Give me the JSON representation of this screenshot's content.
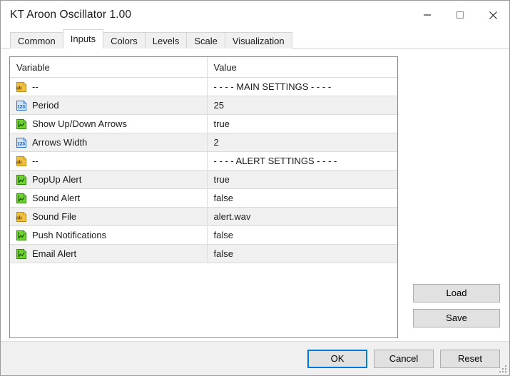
{
  "window": {
    "title": "KT Aroon Oscillator 1.00",
    "controls": [
      {
        "name": "minimize-button",
        "glyph": "minimize"
      },
      {
        "name": "maximize-button",
        "glyph": "maximize"
      },
      {
        "name": "close-button",
        "glyph": "close"
      }
    ]
  },
  "tabs": [
    {
      "label": "Common",
      "active": false
    },
    {
      "label": "Inputs",
      "active": true
    },
    {
      "label": "Colors",
      "active": false
    },
    {
      "label": "Levels",
      "active": false
    },
    {
      "label": "Scale",
      "active": false
    },
    {
      "label": "Visualization",
      "active": false
    }
  ],
  "table": {
    "headers": {
      "variable": "Variable",
      "value": "Value"
    },
    "rows": [
      {
        "icon": "string-icon",
        "variable": "--",
        "value": "- - - - MAIN SETTINGS - - - -",
        "shaded": false
      },
      {
        "icon": "number-icon",
        "variable": "Period",
        "value": "25",
        "shaded": true
      },
      {
        "icon": "boolean-icon",
        "variable": "Show Up/Down Arrows",
        "value": "true",
        "shaded": false
      },
      {
        "icon": "number-icon",
        "variable": "Arrows Width",
        "value": "2",
        "shaded": true
      },
      {
        "icon": "string-icon",
        "variable": "--",
        "value": "- - - - ALERT SETTINGS - - - -",
        "shaded": false
      },
      {
        "icon": "boolean-icon",
        "variable": "PopUp Alert",
        "value": "true",
        "shaded": true
      },
      {
        "icon": "boolean-icon",
        "variable": "Sound Alert",
        "value": "false",
        "shaded": false
      },
      {
        "icon": "string-icon",
        "variable": "Sound File",
        "value": "alert.wav",
        "shaded": true
      },
      {
        "icon": "boolean-icon",
        "variable": "Push Notifications",
        "value": "false",
        "shaded": false
      },
      {
        "icon": "boolean-icon",
        "variable": "Email Alert",
        "value": "false",
        "shaded": true
      }
    ]
  },
  "side_buttons": {
    "load": "Load",
    "save": "Save"
  },
  "bottom_buttons": {
    "ok": "OK",
    "cancel": "Cancel",
    "reset": "Reset"
  },
  "colors": {
    "accent": "#0078d7",
    "row_shaded": "#f0f0f0",
    "row_plain": "#ffffff",
    "grid_line": "#dcdcdc",
    "panel_border": "#8a8a8a",
    "button_face": "#e1e1e1",
    "icon_string": "#e8a72b",
    "icon_number": "#2a6fc9",
    "icon_boolean": "#4cbf2a"
  }
}
